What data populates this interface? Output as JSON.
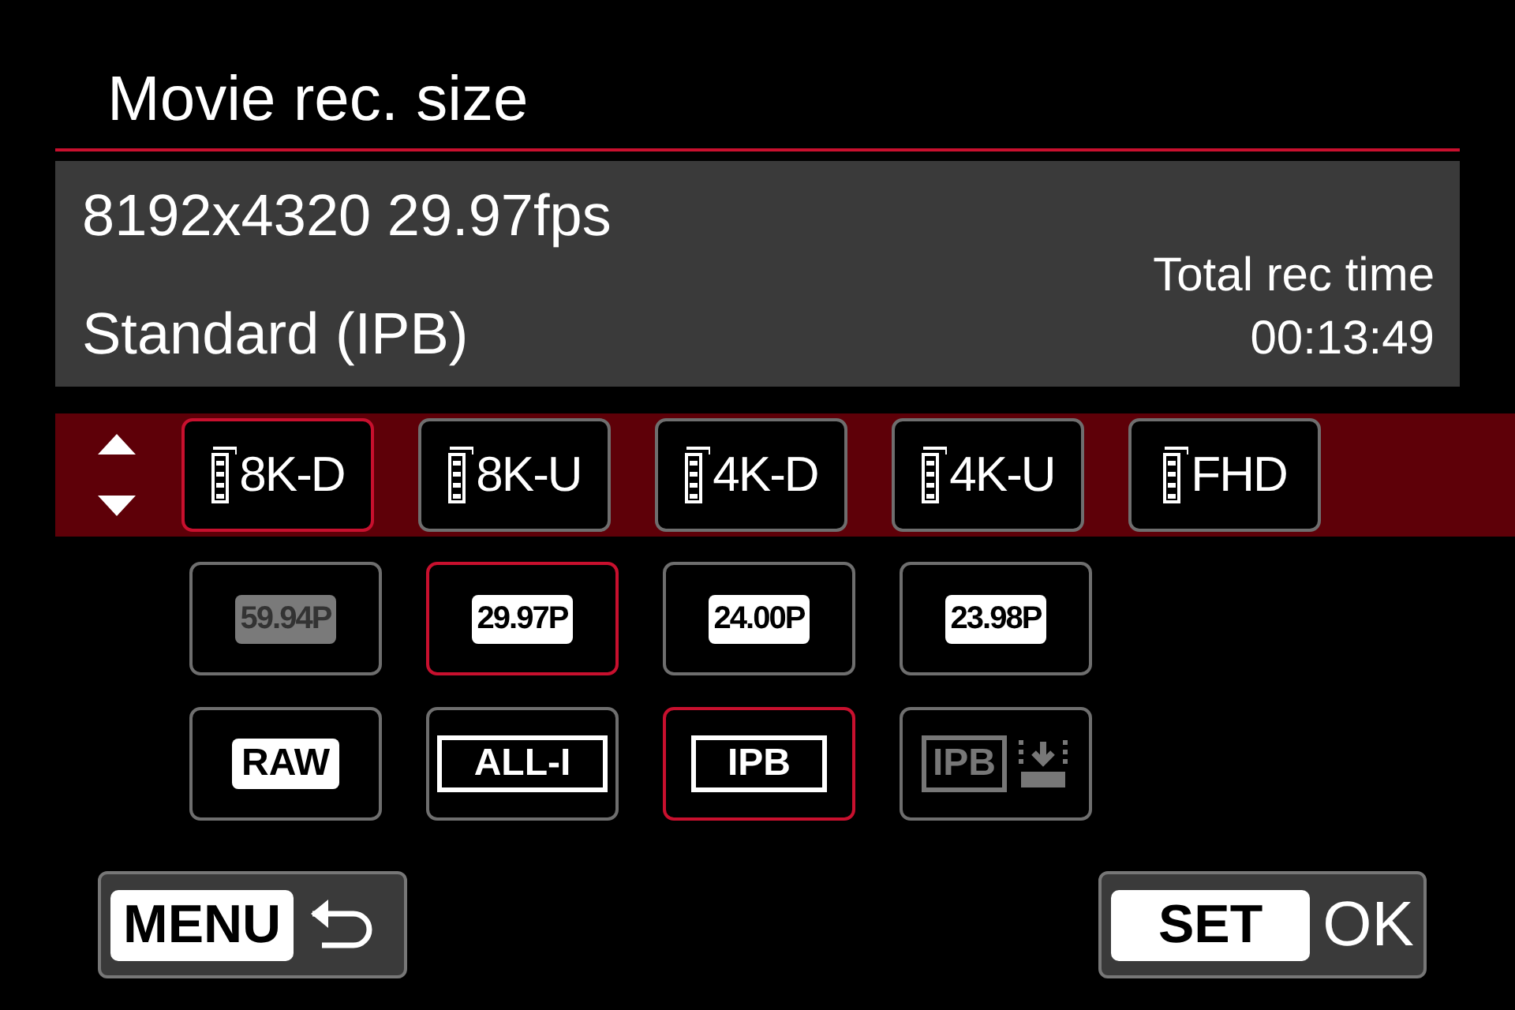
{
  "title": "Movie rec. size",
  "info": {
    "line_1": "8192x4320 29.97fps",
    "line_2": "Standard (IPB)",
    "rec_time_label": "Total rec time",
    "rec_time": "00:13:49"
  },
  "rows": [
    {
      "kind": "size",
      "options": [
        {
          "label": "8K-D",
          "selected": true,
          "disabled": false
        },
        {
          "label": "8K-U",
          "selected": false,
          "disabled": false
        },
        {
          "label": "4K-D",
          "selected": false,
          "disabled": false
        },
        {
          "label": "4K-U",
          "selected": false,
          "disabled": false
        },
        {
          "label": "FHD",
          "selected": false,
          "disabled": false
        }
      ]
    },
    {
      "kind": "rate",
      "options": [
        {
          "label": "59.94P",
          "selected": false,
          "disabled": true
        },
        {
          "label": "29.97P",
          "selected": true,
          "disabled": false
        },
        {
          "label": "24.00P",
          "selected": false,
          "disabled": false
        },
        {
          "label": "23.98P",
          "selected": false,
          "disabled": false
        }
      ]
    },
    {
      "kind": "codec",
      "options": [
        {
          "label": "RAW",
          "kind": "filled",
          "selected": false,
          "disabled": false
        },
        {
          "label": "ALL-I",
          "kind": "outlined",
          "selected": false,
          "disabled": false
        },
        {
          "label": "IPB",
          "kind": "outlined",
          "selected": true,
          "disabled": false
        },
        {
          "label": "IPB",
          "kind": "outlined-save",
          "selected": false,
          "disabled": true
        }
      ]
    }
  ],
  "buttons": {
    "menu": "MENU",
    "set": "SET",
    "ok": "OK"
  }
}
